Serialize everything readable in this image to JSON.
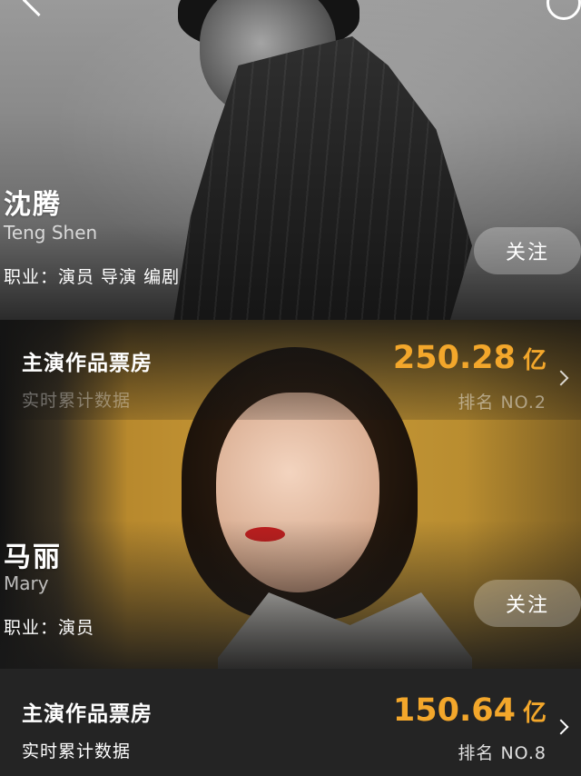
{
  "profile1": {
    "name_cn": "沈腾",
    "name_en": "Teng Shen",
    "job": "职业：演员 导演 编剧",
    "follow_label": "关注"
  },
  "profile1_stats": {
    "title": "主演作品票房",
    "subtitle": "实时累计数据",
    "value": "250.28",
    "unit": "亿",
    "rank": "排名 NO.2"
  },
  "profile2": {
    "name_cn": "马丽",
    "name_en": "Mary",
    "job": "职业：演员",
    "follow_label": "关注"
  },
  "profile2_stats": {
    "title": "主演作品票房",
    "subtitle": "实时累计数据",
    "value": "150.64",
    "unit": "亿",
    "rank": "排名 NO.8"
  },
  "icons": {
    "back": "back-icon",
    "share": "share-icon",
    "chevron": "chevron-right-icon"
  },
  "colors": {
    "accent": "#f3a72b"
  }
}
